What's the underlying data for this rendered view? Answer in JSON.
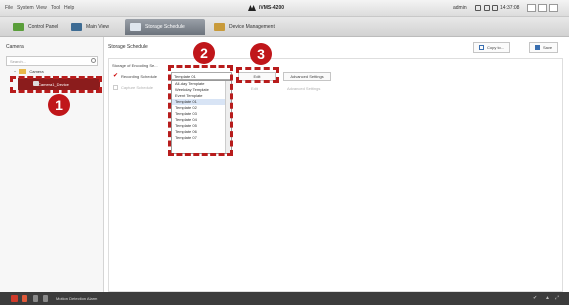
{
  "titlebar": {
    "menus": [
      "File",
      "System",
      "View",
      "Tool",
      "Help"
    ],
    "app_name": "iVMS-4200",
    "user": "admin",
    "clock": "14:37:08"
  },
  "tabs": [
    {
      "label": "Control Panel"
    },
    {
      "label": "Main View"
    },
    {
      "label": "Storage Schedule"
    },
    {
      "label": "Device Management"
    }
  ],
  "left": {
    "heading": "Camera",
    "search_placeholder": "Search...",
    "tree_root": "Camera",
    "tree_child": "Camera1_Device"
  },
  "main": {
    "heading": "Storage Schedule",
    "copy_to": "Copy to...",
    "save": "Save",
    "subheading": "Storage of Encoding Se...",
    "recording_label": "Recording Schedule",
    "capture_label": "Capture Schedule",
    "recording_value": "Template 01",
    "edit": "Edit",
    "advanced": "Advanced Settings"
  },
  "dropdown_options": [
    "All-day Template",
    "Weekday Template",
    "Event Template",
    "Template 01",
    "Template 02",
    "Template 03",
    "Template 04",
    "Template 05",
    "Template 06",
    "Template 07"
  ],
  "callouts": [
    "1",
    "2",
    "3"
  ],
  "statusbar": {
    "text": "Motion Detection Alarm"
  },
  "colors": {
    "callout_red": "#c0161a",
    "selected_item": "#8b1c1c",
    "active_tab": "#6c737c"
  }
}
